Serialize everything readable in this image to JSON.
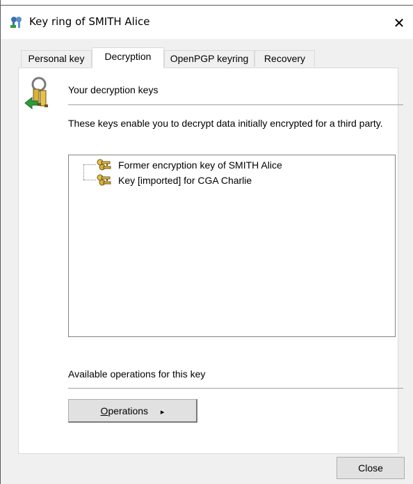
{
  "window": {
    "title": "Key ring of SMITH Alice",
    "close_glyph": "✕",
    "icon": "key-ring-icon"
  },
  "tabs": [
    {
      "label": "Personal key",
      "active": false
    },
    {
      "label": "Decryption",
      "active": true
    },
    {
      "label": "OpenPGP keyring",
      "active": false
    },
    {
      "label": "Recovery",
      "active": false
    }
  ],
  "decryption": {
    "section_title": "Your decryption keys",
    "description": "These keys enable you to decrypt data initially encrypted for a third party.",
    "keys": [
      {
        "label": "Former encryption key of SMITH Alice",
        "icon": "key-icon"
      },
      {
        "label": "Key [imported] for CGA Charlie",
        "icon": "key-icon"
      }
    ],
    "operations_label": "Available operations for this key",
    "operations_button": {
      "accel": "O",
      "rest": "perations",
      "arrow": "▸"
    }
  },
  "footer": {
    "close_label": "Close"
  },
  "colors": {
    "dialog_bg": "#f0f0f0",
    "panel_bg": "#ffffff",
    "button_bg": "#e1e1e1",
    "key_gold": "#d9b23a",
    "arrow_green": "#2e9b3a"
  }
}
